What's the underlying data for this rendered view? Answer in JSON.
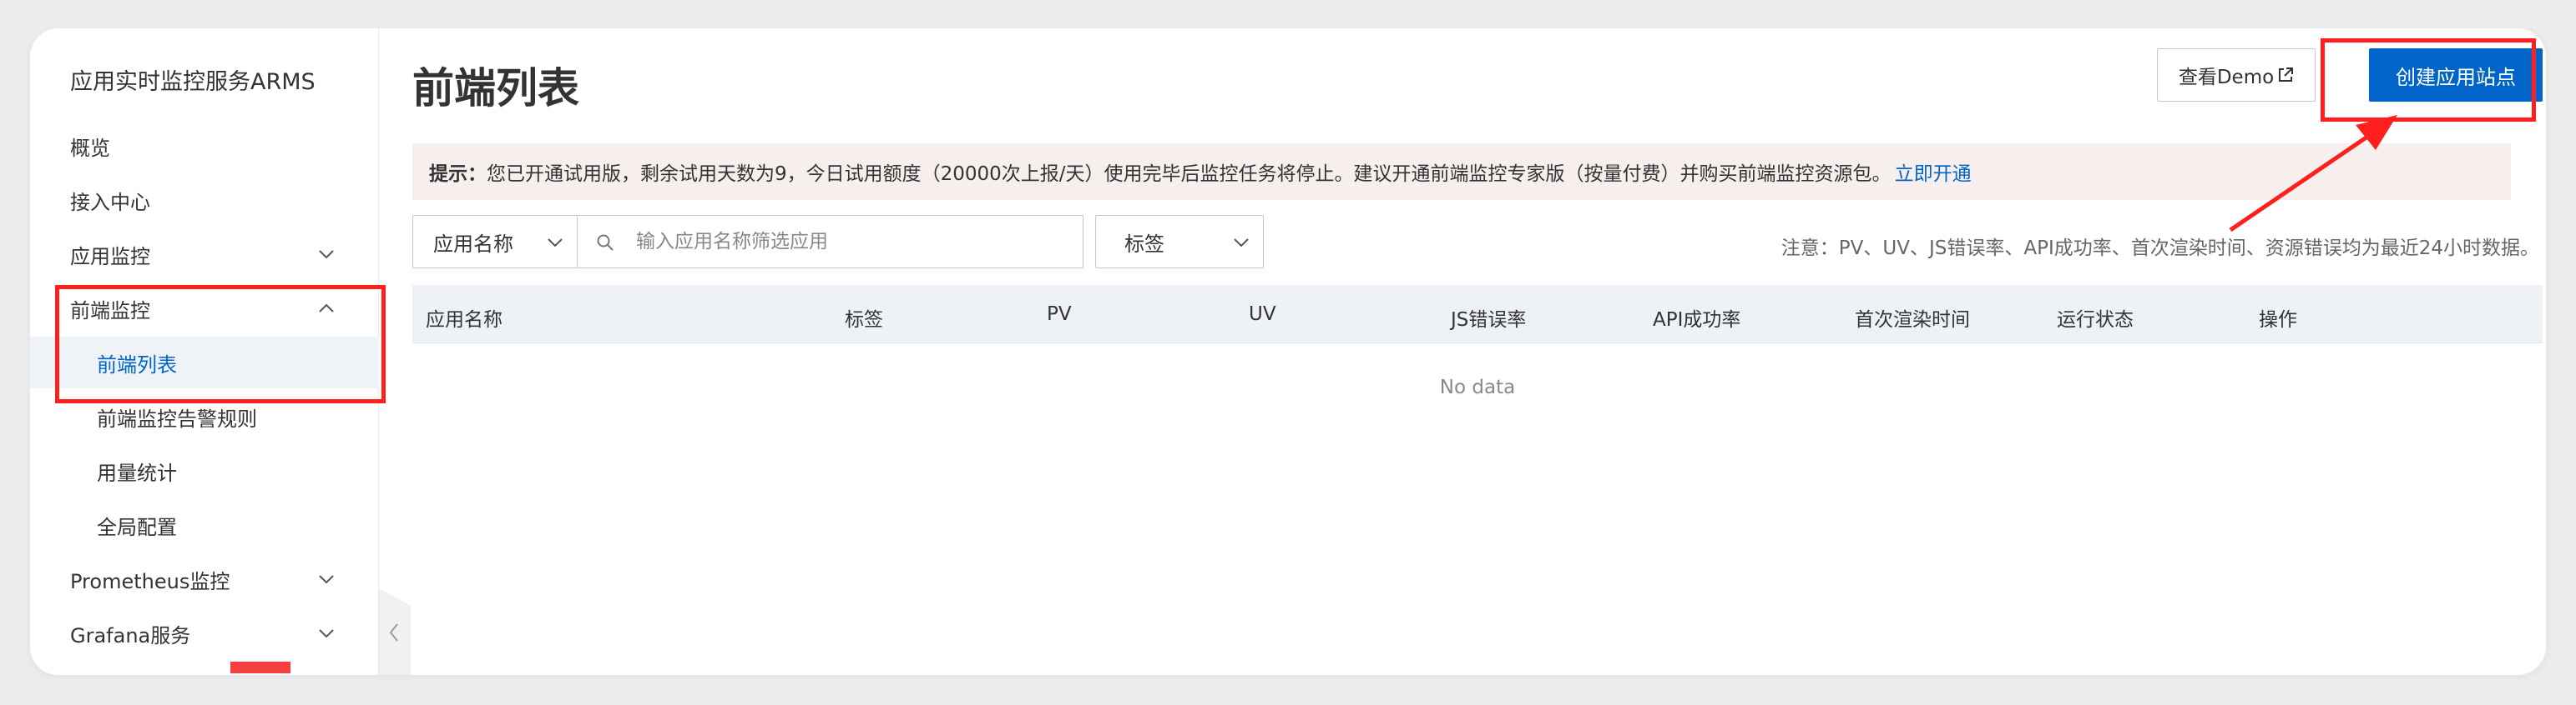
{
  "sidebar": {
    "title": "应用实时监控服务ARMS",
    "items": [
      {
        "label": "概览"
      },
      {
        "label": "接入中心"
      },
      {
        "label": "应用监控"
      },
      {
        "label": "前端监控"
      },
      {
        "label": "前端列表"
      },
      {
        "label": "前端监控告警规则"
      },
      {
        "label": "用量统计"
      },
      {
        "label": "全局配置"
      },
      {
        "label": "Prometheus监控"
      },
      {
        "label": "Grafana服务"
      }
    ]
  },
  "header": {
    "title": "前端列表",
    "demo_label": "查看Demo",
    "create_label": "创建应用站点"
  },
  "tip": {
    "label": "提示：",
    "text": "您已开通试用版，剩余试用天数为9，今日试用额度（20000次上报/天）使用完毕后监控任务将停止。建议开通前端监控专家版（按量付费）并购买前端监控资源包。",
    "link": "立即开通"
  },
  "filters": {
    "field_select": "应用名称",
    "search_placeholder": "输入应用名称筛选应用",
    "tag_select": "标签",
    "note": "注意：PV、UV、JS错误率、API成功率、首次渲染时间、资源错误均为最近24小时数据。"
  },
  "table": {
    "columns": [
      "应用名称",
      "标签",
      "PV",
      "UV",
      "JS错误率",
      "API成功率",
      "首次渲染时间",
      "运行状态",
      "操作"
    ],
    "empty_text": "No data"
  },
  "colors": {
    "accent": "#0064c8",
    "annotation": "#ff1f1f",
    "tip_background": "#f7eeee",
    "table_header": "#eef1f6"
  }
}
